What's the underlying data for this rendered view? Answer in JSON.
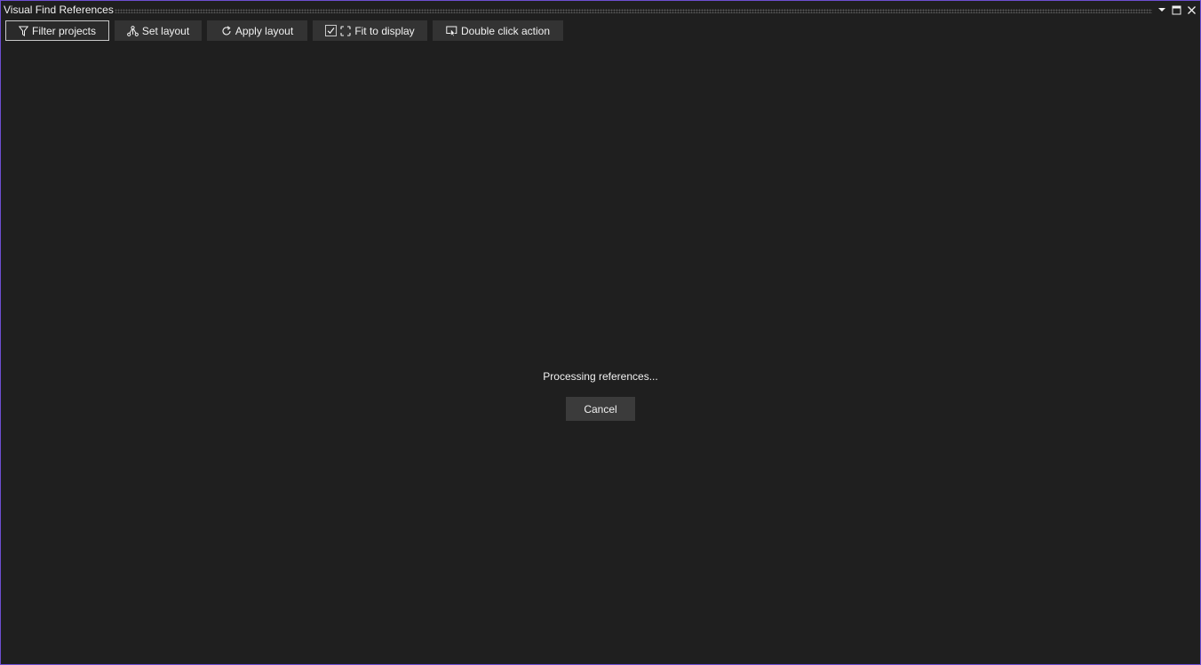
{
  "window": {
    "title": "Visual Find References",
    "controls": {
      "dropdown_icon": "chevron-down-icon",
      "maximize_icon": "maximize-icon",
      "close_icon": "close-icon"
    }
  },
  "toolbar": {
    "filter_projects": {
      "label": "Filter projects",
      "icon": "filter-icon",
      "active": true
    },
    "set_layout": {
      "label": "Set layout",
      "icon": "hierarchy-icon"
    },
    "apply_layout": {
      "label": "Apply layout",
      "icon": "refresh-icon"
    },
    "fit_to_display": {
      "label": "Fit to display",
      "icon": "fit-screen-icon",
      "checked": true
    },
    "double_click_action": {
      "label": "Double click action",
      "icon": "mouse-click-icon"
    }
  },
  "main": {
    "status_text": "Processing references...",
    "cancel_label": "Cancel"
  },
  "colors": {
    "background": "#1f1f1f",
    "button_background": "#333333",
    "accent_border": "#6e4fd1",
    "text": "#f1f1f1"
  }
}
